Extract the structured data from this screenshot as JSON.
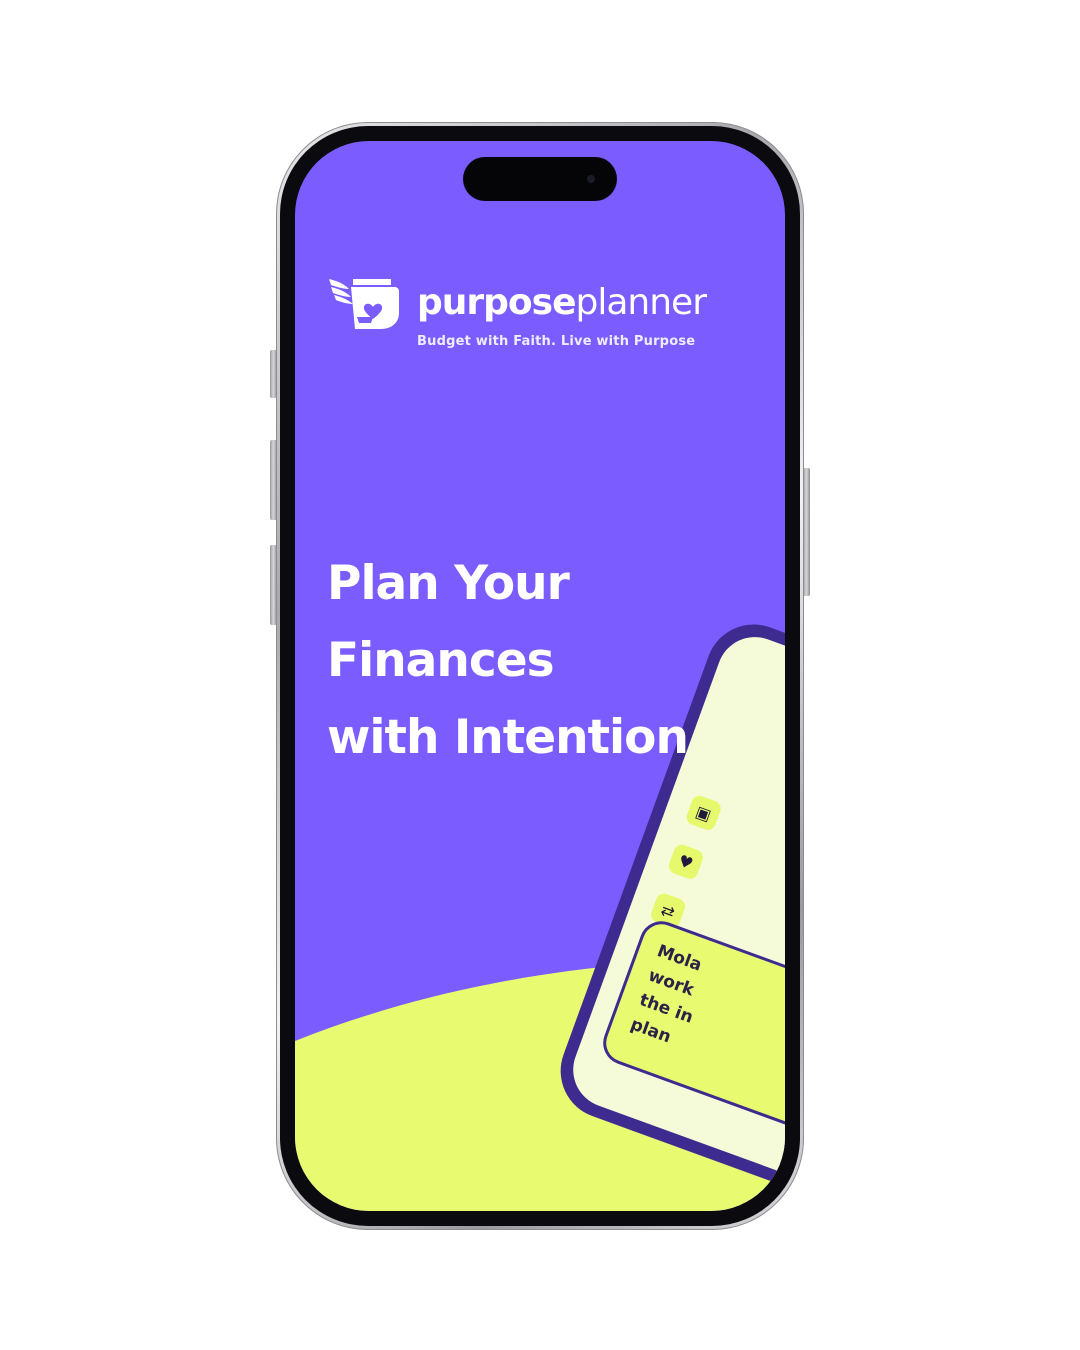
{
  "brand": {
    "name_bold": "purpose",
    "name_light": "planner",
    "tagline": "Budget with Faith. Live with Purpose",
    "logo_icon": "winged-wallet-heart-icon"
  },
  "hero": {
    "lines": [
      "Plan Your",
      "Finances",
      "with Intention"
    ]
  },
  "preview": {
    "icons": [
      "calendar-icon",
      "heart-icon",
      "handshake-icon"
    ],
    "icon_glyphs": [
      "▣",
      "♥",
      "⇄"
    ],
    "card_lines": [
      "Mola",
      "work",
      "the in",
      "plan"
    ]
  },
  "colors": {
    "screen_bg": "#7a5cff",
    "accent_lime": "#e8fa70",
    "text_white": "#ffffff",
    "mockup_frame": "#3d2b8f"
  }
}
